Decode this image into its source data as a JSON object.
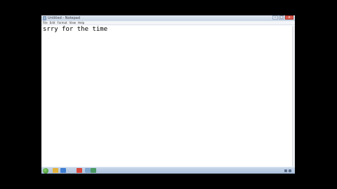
{
  "window": {
    "title": "Untitled - Notepad",
    "minimize_glyph": "–",
    "maximize_glyph": "□",
    "close_glyph": "x"
  },
  "menu": {
    "items": [
      "File",
      "Edit",
      "Format",
      "View",
      "Help"
    ]
  },
  "editor": {
    "text": "srry for the time"
  },
  "taskbar": {
    "icons": [
      {
        "name": "explorer-icon",
        "color": "#e3b23c"
      },
      {
        "name": "media-player-icon",
        "color": "#3f7fd1"
      },
      {
        "name": "chrome-icon",
        "color": "#d9483b"
      },
      {
        "name": "notepad-icon",
        "color": "#7fa6cf"
      },
      {
        "name": "paint-icon",
        "color": "#4b9a64"
      }
    ],
    "clock_time": "",
    "clock_date": ""
  }
}
